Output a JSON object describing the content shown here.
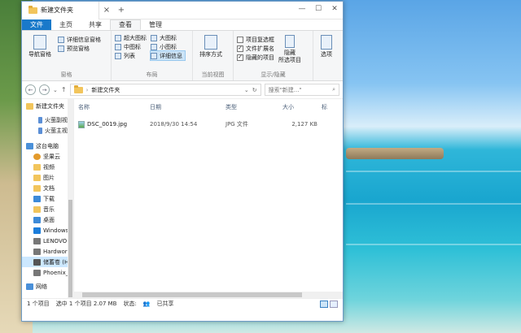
{
  "window": {
    "tab_title": "新建文件夹",
    "close_tab": "×",
    "new_tab": "+"
  },
  "ribbon_tabs": [
    "文件",
    "主页",
    "共享",
    "查看",
    "管理"
  ],
  "ribbon": {
    "panes": {
      "nav_pane": "导航窗格",
      "details_pane": "详细信息窗格",
      "preview_pane": "预览窗格",
      "label": "窗格"
    },
    "layout": {
      "items": [
        "超大图标",
        "大图标",
        "中图标",
        "小图标",
        "列表",
        "详细信息"
      ],
      "label": "布局"
    },
    "current_view": {
      "sort_by": "排序方式",
      "label": "当前视图"
    },
    "show_hide": {
      "item_checkbox": "项目复选框",
      "file_ext": "文件扩展名",
      "hidden_items": "隐藏的项目",
      "hide": "隐藏",
      "hide_selected": "所选项目",
      "label": "显示/隐藏"
    },
    "options": "选项"
  },
  "address": {
    "path": "新建文件夹",
    "search_placeholder": "搜索\"新建...\""
  },
  "nav": {
    "items": [
      {
        "label": "新建文件夹",
        "icon": "folder-icon",
        "color": "#f2c55c"
      },
      {
        "label": "火萤副视频",
        "icon": "file-icon",
        "color": "#5b8fd6"
      },
      {
        "label": "火萤主视频",
        "icon": "file-icon",
        "color": "#5b8fd6"
      },
      {
        "label": "这台电脑",
        "icon": "computer-icon",
        "color": "#4a90d9"
      },
      {
        "label": "坚果云",
        "icon": "nut-icon",
        "color": "#e39a2b"
      },
      {
        "label": "视频",
        "icon": "video-folder-icon",
        "color": "#f2c55c"
      },
      {
        "label": "图片",
        "icon": "picture-folder-icon",
        "color": "#f2c55c"
      },
      {
        "label": "文档",
        "icon": "document-folder-icon",
        "color": "#f2c55c"
      },
      {
        "label": "下载",
        "icon": "download-folder-icon",
        "color": "#3d8ad8"
      },
      {
        "label": "音乐",
        "icon": "music-folder-icon",
        "color": "#f2c55c"
      },
      {
        "label": "桌面",
        "icon": "desktop-folder-icon",
        "color": "#3d8ad8"
      },
      {
        "label": "Windows",
        "icon": "windows-drive-icon",
        "color": "#1b7ddb"
      },
      {
        "label": "LENOVO",
        "icon": "drive-icon",
        "color": "#777777"
      },
      {
        "label": "Hardwor",
        "icon": "drive-icon",
        "color": "#777777"
      },
      {
        "label": "储蓄卷 (H",
        "icon": "drive-icon",
        "color": "#555555"
      },
      {
        "label": "Phoenix_",
        "icon": "drive-icon",
        "color": "#777777"
      },
      {
        "label": "网络",
        "icon": "network-icon",
        "color": "#4a90d9"
      }
    ]
  },
  "table": {
    "headers": [
      "名称",
      "日期",
      "类型",
      "大小",
      "标"
    ],
    "rows": [
      {
        "name": "DSC_0019.jpg",
        "date": "2018/9/30 14:54",
        "type": "JPG 文件",
        "size": "2,127 KB"
      }
    ]
  },
  "status": {
    "count": "1 个项目",
    "selected": "选中 1 个项目  2.07 MB",
    "state": "状态:",
    "shared": "已共享"
  },
  "colors": {
    "accent": "#1979ca",
    "selection": "#cce8ff"
  }
}
